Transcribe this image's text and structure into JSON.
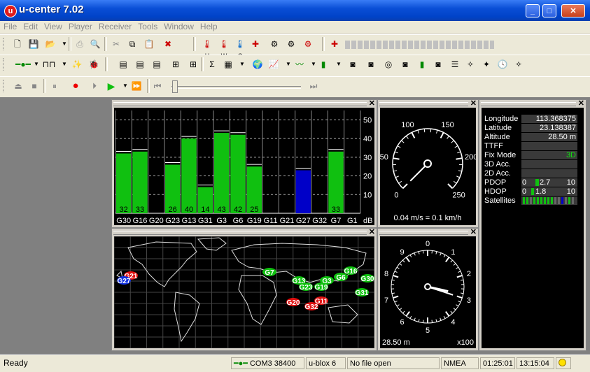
{
  "window": {
    "title": "u-center 7.02",
    "logo_letter": "u"
  },
  "menu": [
    "File",
    "Edit",
    "View",
    "Player",
    "Receiver",
    "Tools",
    "Window",
    "Help"
  ],
  "toolbar_icons": {
    "h": "H",
    "w": "W",
    "c": "C"
  },
  "chart_data": {
    "type": "bar",
    "categories": [
      "G30",
      "G16",
      "G20",
      "G23",
      "G13",
      "G31",
      "G3",
      "G6",
      "G19",
      "G11",
      "G21",
      "G27",
      "G32",
      "G7",
      "G1"
    ],
    "values": [
      32,
      33,
      0,
      26,
      40,
      14,
      43,
      42,
      25,
      0,
      0,
      23,
      0,
      33,
      0
    ],
    "value_labels": [
      "32",
      "33",
      "",
      "26",
      "40",
      "14",
      "43",
      "42",
      "25",
      "",
      "",
      "",
      "",
      "33",
      ""
    ],
    "series_colors": [
      "green",
      "green",
      "green",
      "green",
      "green",
      "green",
      "green",
      "green",
      "green",
      "green",
      "green",
      "blue",
      "green",
      "green",
      "green"
    ],
    "ylim": [
      0,
      55
    ],
    "yticks": [
      "50",
      "40",
      "30",
      "20",
      "10"
    ],
    "unit": "dB",
    "grid": true
  },
  "world_map": {
    "satellites": [
      {
        "id": "G21",
        "color": "#e01010"
      },
      {
        "id": "G27",
        "color": "#1030e0"
      },
      {
        "id": "G7",
        "color": "#10c010"
      },
      {
        "id": "G16",
        "color": "#10c010"
      },
      {
        "id": "G13",
        "color": "#10c010"
      },
      {
        "id": "G6",
        "color": "#10c010"
      },
      {
        "id": "G3",
        "color": "#10c010"
      },
      {
        "id": "G23",
        "color": "#10c010"
      },
      {
        "id": "G19",
        "color": "#10c010"
      },
      {
        "id": "G31",
        "color": "#10c010"
      },
      {
        "id": "G30",
        "color": "#10c010"
      },
      {
        "id": "G20",
        "color": "#e01010"
      },
      {
        "id": "G11",
        "color": "#e01010"
      },
      {
        "id": "G32",
        "color": "#e01010"
      }
    ]
  },
  "speedometer": {
    "ticks": [
      "0",
      "50",
      "100",
      "150",
      "200",
      "250"
    ],
    "speed_ms": 0.04,
    "speed_text": "0.04 m/s = 0.1 km/h"
  },
  "altimeter": {
    "numbers": [
      "0",
      "1",
      "2",
      "3",
      "4",
      "5",
      "6",
      "7",
      "8",
      "9"
    ],
    "altitude_text": "28.50 m",
    "scale": "x100"
  },
  "info": {
    "rows": [
      {
        "label": "Longitude",
        "value": "113.368375"
      },
      {
        "label": "Latitude",
        "value": "23.138387"
      },
      {
        "label": "Altitude",
        "value": "28.50 m"
      },
      {
        "label": "TTFF",
        "value": ""
      },
      {
        "label": "Fix Mode",
        "value": "3D"
      },
      {
        "label": "3D Acc.",
        "value": ""
      },
      {
        "label": "2D Acc.",
        "value": ""
      }
    ],
    "pdop": {
      "label": "PDOP",
      "min": "0",
      "value": "2.7",
      "max": "10",
      "fraction": 0.27
    },
    "hdop": {
      "label": "HDOP",
      "min": "0",
      "value": "1.8",
      "max": "10",
      "fraction": 0.18
    },
    "satellites_label": "Satellites"
  },
  "status": {
    "ready": "Ready",
    "port": "COM3 38400",
    "receiver": "u-blox 6",
    "file": "No file open",
    "protocol": "NMEA",
    "uptime": "01:25:01",
    "clock": "13:15:04"
  },
  "colors": {
    "bar_green": "#10c010",
    "bar_blue": "#0000c8",
    "fix_green": "#10e010"
  }
}
